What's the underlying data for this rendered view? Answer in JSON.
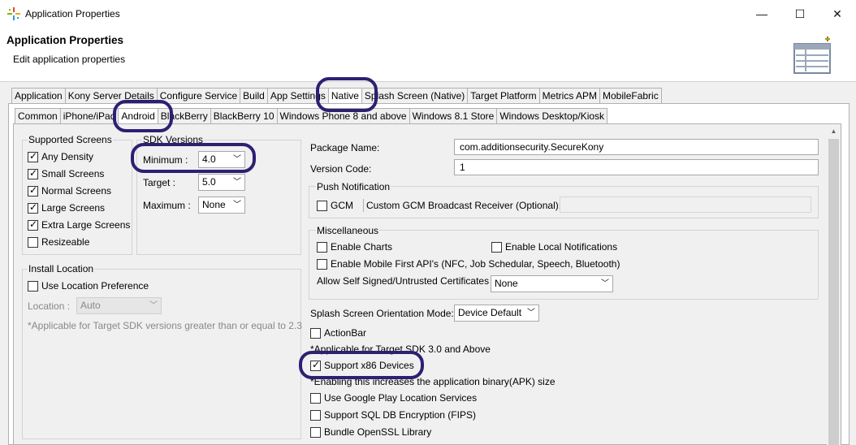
{
  "window": {
    "title": "Application Properties",
    "controls": {
      "minimize": "—",
      "maximize": "☐",
      "close": "✕"
    }
  },
  "header": {
    "title": "Application Properties",
    "subtitle": "Edit application properties"
  },
  "tabs_top": [
    "Application",
    "Kony Server Details",
    "Configure Service",
    "Build",
    "App Settings",
    "Native",
    "Splash Screen (Native)",
    "Target Platform",
    "Metrics APM",
    "MobileFabric"
  ],
  "tabs_platform": [
    "Common",
    "iPhone/iPad",
    "Android",
    "BlackBerry",
    "BlackBerry 10",
    "Windows Phone 8 and above",
    "Windows 8.1 Store",
    "Windows Desktop/Kiosk"
  ],
  "supported_screens": {
    "title": "Supported Screens",
    "items": [
      {
        "label": "Any Density",
        "checked": "✓"
      },
      {
        "label": "Small Screens",
        "checked": "✓"
      },
      {
        "label": "Normal Screens",
        "checked": "✓"
      },
      {
        "label": "Large Screens",
        "checked": "✓"
      },
      {
        "label": "Extra Large Screens",
        "checked": "✓"
      },
      {
        "label": "Resizeable",
        "checked": ""
      }
    ]
  },
  "sdk_versions": {
    "title": "SDK Versions",
    "minimum_label": "Minimum :",
    "minimum_value": "4.0",
    "target_label": "Target :",
    "target_value": "5.0",
    "maximum_label": "Maximum :",
    "maximum_value": "None"
  },
  "install_location": {
    "title": "Install Location",
    "use_pref_label": "Use Location Preference",
    "location_label": "Location :",
    "location_value": "Auto",
    "note": "*Applicable for Target SDK versions greater than or equal to 2.3"
  },
  "package": {
    "name_label": "Package Name:",
    "name_value": "com.additionsecurity.SecureKony",
    "version_label": "Version Code:",
    "version_value": "1"
  },
  "push": {
    "title": "Push Notification",
    "gcm_label": "GCM",
    "receiver_label": "Custom GCM Broadcast Receiver (Optional):",
    "receiver_value": ""
  },
  "misc": {
    "title": "Miscellaneous",
    "enable_charts": "Enable Charts",
    "enable_local_notifications": "Enable Local Notifications",
    "enable_mobile_first": "Enable Mobile First API's (NFC, Job Schedular, Speech, Bluetooth)",
    "self_signed_label": "Allow Self Signed/Untrusted Certificates",
    "self_signed_value": "None"
  },
  "splash": {
    "orientation_label": "Splash Screen Orientation Mode:",
    "orientation_value": "Device Default",
    "actionbar_label": "ActionBar",
    "actionbar_note": "*Applicable for Target SDK 3.0 and Above",
    "x86_label": "Support x86 Devices",
    "x86_checked": "✓",
    "x86_note": "*Enabling this increases the application binary(APK) size",
    "google_play_label": "Use Google Play Location Services",
    "sql_label": "Support SQL DB Encryption (FIPS)",
    "openssl_label": "Bundle OpenSSL Library"
  },
  "colors": {
    "highlight_ring": "#2c2073"
  },
  "icons": {
    "app": "kony-logo-icon",
    "header": "properties-table-icon",
    "combo": "chevron-down-icon"
  }
}
